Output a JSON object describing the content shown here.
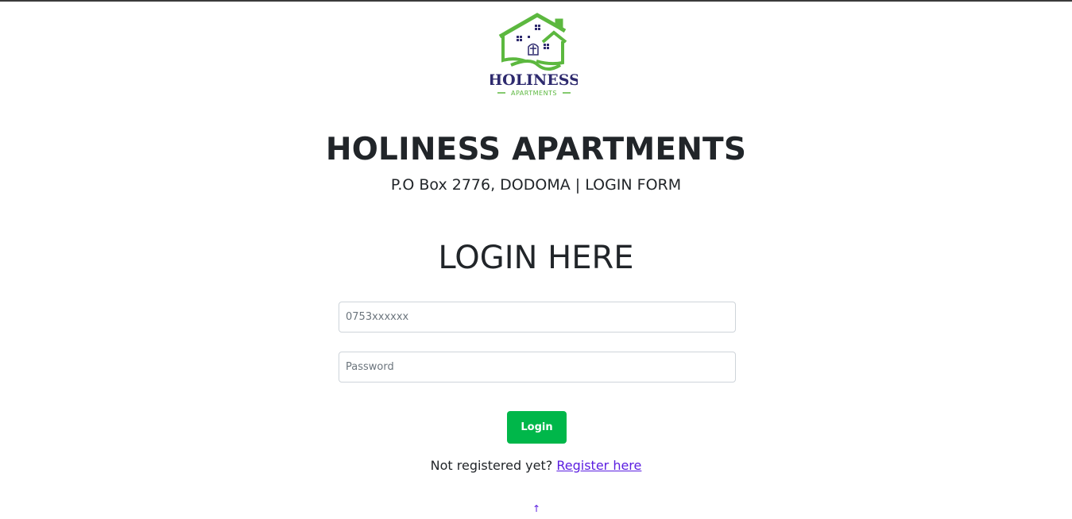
{
  "logo": {
    "icon": "house-logo",
    "wordmark": "HOLINESS",
    "tagline": "APARTMENTS",
    "colors": {
      "green": "#5cb83f",
      "navy": "#2e2a6e"
    }
  },
  "header": {
    "title": "HOLINESS APARTMENTS",
    "subtitle": "P.O Box 2776, DODOMA | LOGIN FORM"
  },
  "form": {
    "title": "LOGIN HERE",
    "phone": {
      "value": "",
      "placeholder": "0753xxxxxx"
    },
    "password": {
      "value": "",
      "placeholder": "Password"
    },
    "submit_label": "Login",
    "submit_color": "#00b74a"
  },
  "footer": {
    "register_prompt": "Not registered yet?",
    "register_link": "Register here",
    "back_to_top_icon": "arrow-up-icon",
    "back_to_top_glyph": "↑",
    "link_color": "#5b1ee0"
  }
}
